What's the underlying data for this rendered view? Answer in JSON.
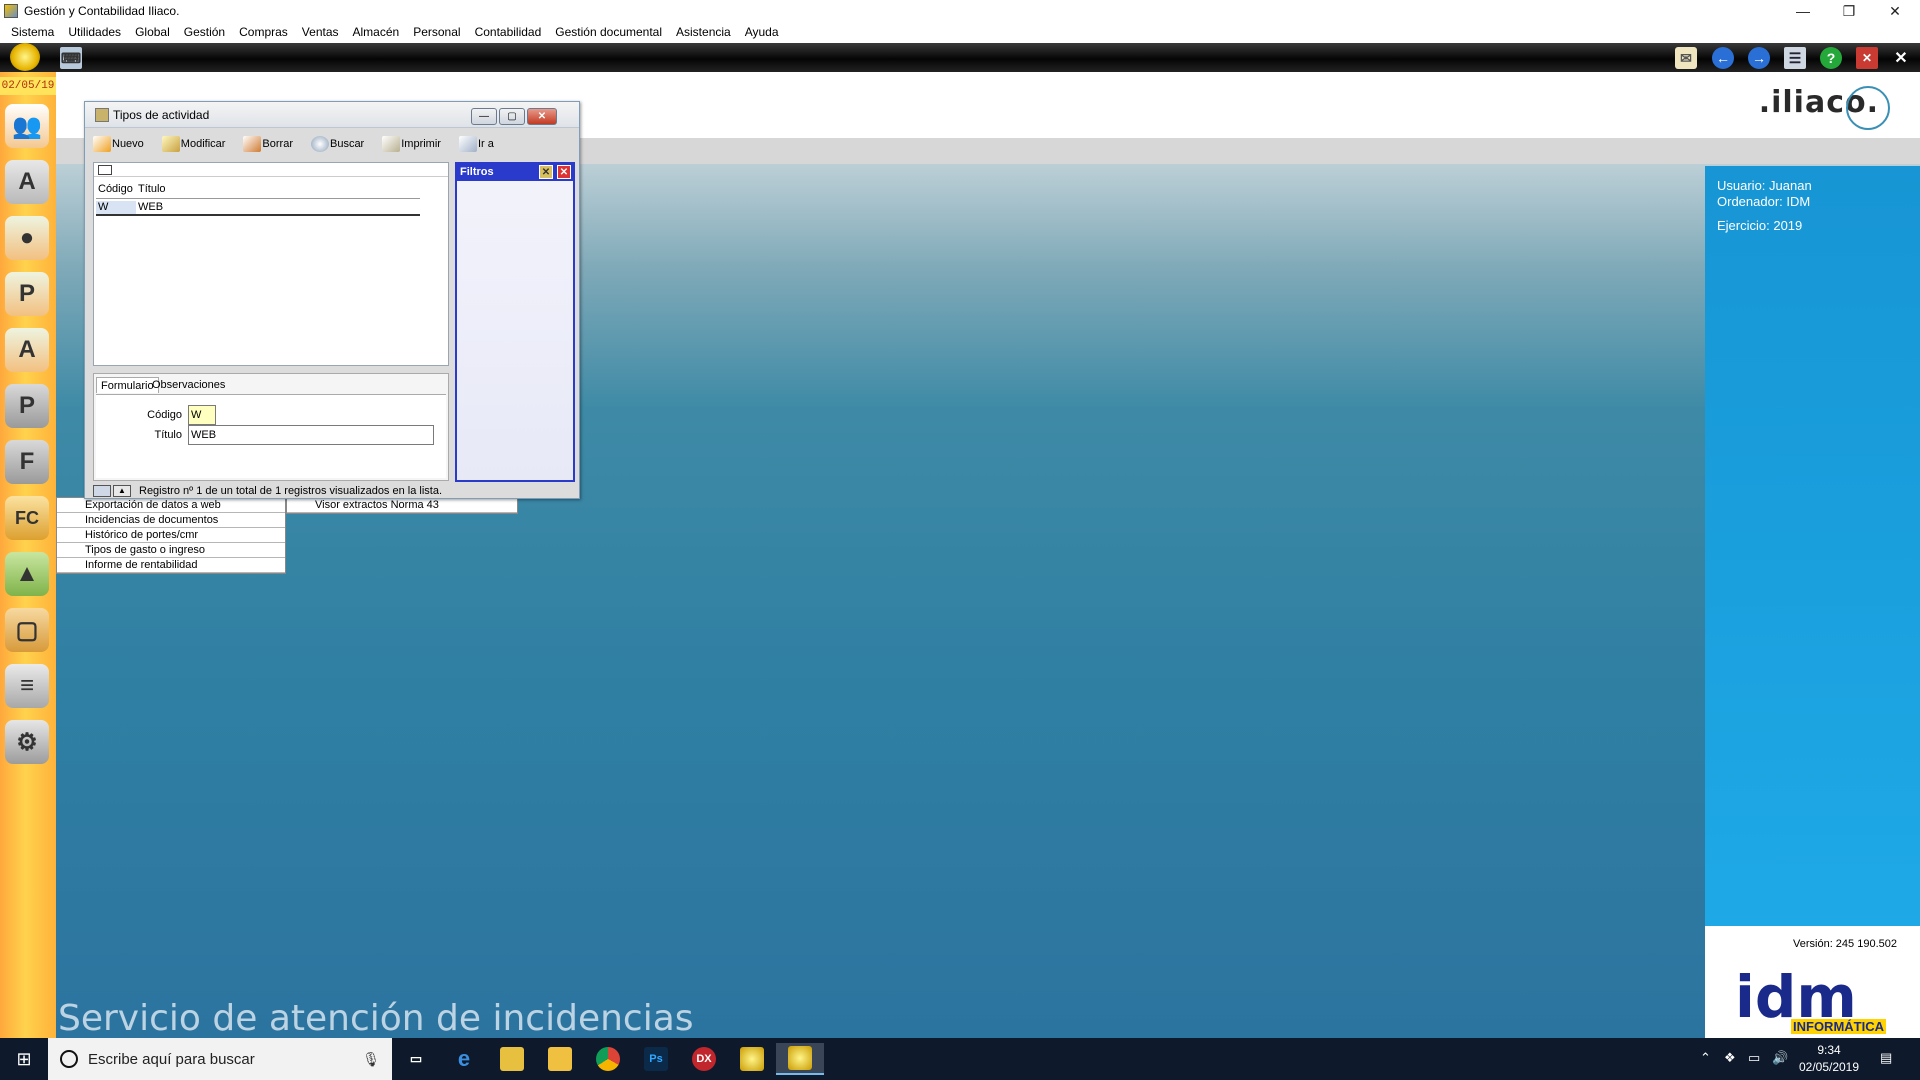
{
  "window": {
    "title": "Gestión y Contabilidad Iliaco.",
    "minimize": "—",
    "restore": "❐",
    "close": "✕"
  },
  "menu": [
    "Sistema",
    "Utilidades",
    "Global",
    "Gestión",
    "Compras",
    "Ventas",
    "Almacén",
    "Personal",
    "Contabilidad",
    "Gestión documental",
    "Asistencia",
    "Ayuda"
  ],
  "sidebar": {
    "date": "02/05/19",
    "icons": [
      "users-icon",
      "address-book-icon",
      "user-icon",
      "user-p-icon",
      "user-a-icon",
      "p-icon",
      "f-icon",
      "fc-icon",
      "bag-icon",
      "box-icon",
      "list-icon",
      "tools-icon"
    ]
  },
  "workspace": {
    "logo": ".iliaco.",
    "service": "Servicio de atención de incidencias"
  },
  "info": {
    "usuario": "Usuario: Juanan",
    "ordenador": "Ordenador: IDM",
    "ejercicio": "Ejercicio: 2019",
    "version": "Versión: 245 190.502",
    "brand_main": "idm",
    "brand_sub": "INFORMÁTICA"
  },
  "bg_menu_left": [
    "Exportación de datos a web",
    "Incidencias de documentos",
    "Histórico de portes/cmr",
    "Tipos de gasto o ingreso",
    "Informe de rentabilidad"
  ],
  "bg_menu_right": [
    "Visor extractos Norma 43"
  ],
  "dialog": {
    "title": "Tipos de actividad",
    "toolbar": [
      "Nuevo",
      "Modificar",
      "Borrar",
      "Buscar",
      "Imprimir",
      "Ir a"
    ],
    "columns": [
      "Código",
      "Título"
    ],
    "rows": [
      [
        "W",
        "WEB"
      ]
    ],
    "filters_title": "Filtros",
    "tabs": [
      "Formulario",
      "Observaciones"
    ],
    "form": {
      "codigo_label": "Código",
      "codigo_value": "W",
      "titulo_label": "Título",
      "titulo_value": "WEB"
    },
    "status": "Registro nº 1 de un total de 1 registros visualizados en la lista."
  },
  "taskbar": {
    "search_placeholder": "Escribe aquí para buscar",
    "time": "9:34",
    "date": "02/05/2019",
    "apps": [
      "task-view-icon",
      "edge-icon",
      "mail-app-icon",
      "file-explorer-icon",
      "chrome-icon",
      "photoshop-icon",
      "dx-icon",
      "iliaco-icon",
      "iliaco-active-icon"
    ]
  }
}
